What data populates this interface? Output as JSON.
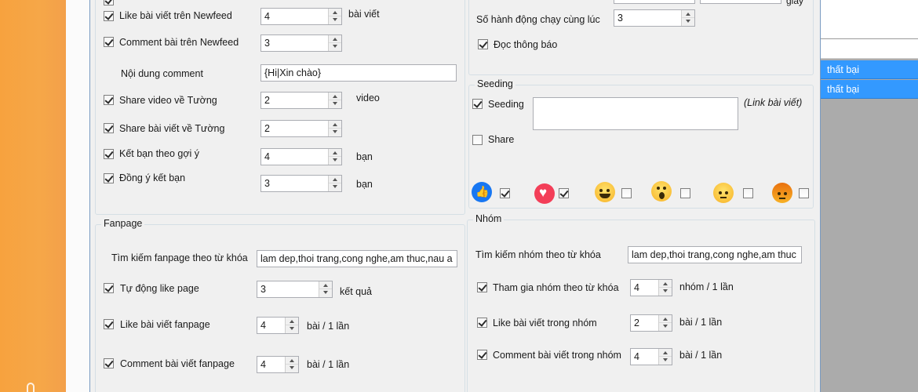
{
  "background": {
    "right_rows": [
      "thất bại",
      "thất bại"
    ],
    "colors": {
      "orange": "#f7a23e",
      "selection": "#3399ff"
    }
  },
  "newfeed": {
    "like": {
      "label": "Like bài viết trên Newfeed",
      "checked": true,
      "value": "4",
      "unit": "bài viết"
    },
    "comment": {
      "label": "Comment bài trên Newfeed",
      "checked": true,
      "value": "3"
    },
    "comment_content": {
      "label": "Nội dung comment",
      "value": "{Hi|Xin chào}"
    },
    "share_video": {
      "label": "Share video về Tường",
      "checked": true,
      "value": "2",
      "unit": "video"
    },
    "share_post": {
      "label": "Share bài viết về Tường",
      "checked": true,
      "value": "2"
    },
    "add_friend": {
      "label": "Kết bạn theo gợi ý",
      "checked": true,
      "value": "4",
      "unit": "bạn"
    },
    "accept_friend": {
      "label": "Đồng ý kết bạn",
      "checked": true,
      "value": "3",
      "unit": "bạn"
    }
  },
  "settings": {
    "concurrent": {
      "label": "Số hành động chạy cùng lúc",
      "value": "3"
    },
    "read_notifications": {
      "label": "Đọc thông báo",
      "checked": true
    },
    "top_right_unit": "giây"
  },
  "seeding": {
    "title": "Seeding",
    "seeding_label": "Seeding",
    "seeding_checked": true,
    "link_hint": "(Link bài viết)",
    "share_label": "Share",
    "share_checked": false,
    "reactions": [
      {
        "icon": "like-reaction-icon",
        "checked": true
      },
      {
        "icon": "love-reaction-icon",
        "checked": true
      },
      {
        "icon": "haha-reaction-icon",
        "checked": false
      },
      {
        "icon": "wow-reaction-icon",
        "checked": false
      },
      {
        "icon": "sad-reaction-icon",
        "checked": false
      },
      {
        "icon": "angry-reaction-icon",
        "checked": false
      }
    ]
  },
  "fanpage": {
    "title": "Fanpage",
    "search": {
      "label": "Tìm kiếm fanpage theo từ khóa",
      "value": "lam dep,thoi trang,cong nghe,am thuc,nau a"
    },
    "auto_like": {
      "label": "Tự động like page",
      "checked": true,
      "value": "3",
      "unit": "kết quả"
    },
    "like_post": {
      "label": "Like bài viết fanpage",
      "checked": true,
      "value": "4",
      "unit": "bài / 1 lần"
    },
    "comment_post": {
      "label": "Comment bài viết fanpage",
      "checked": true,
      "value": "4",
      "unit": "bài / 1 lần"
    }
  },
  "group": {
    "title": "Nhóm",
    "search": {
      "label": "Tìm kiếm nhóm theo từ khóa",
      "value": "lam dep,thoi trang,cong nghe,am thuc"
    },
    "join": {
      "label": "Tham gia nhóm theo từ khóa",
      "checked": true,
      "value": "4",
      "unit": "nhóm / 1 lần"
    },
    "like_post": {
      "label": "Like bài viết trong nhóm",
      "checked": true,
      "value": "2",
      "unit": "bài / 1 lần"
    },
    "comment_post": {
      "label": "Comment bài viết trong nhóm",
      "checked": true,
      "value": "4",
      "unit": "bài / 1 lần"
    }
  }
}
